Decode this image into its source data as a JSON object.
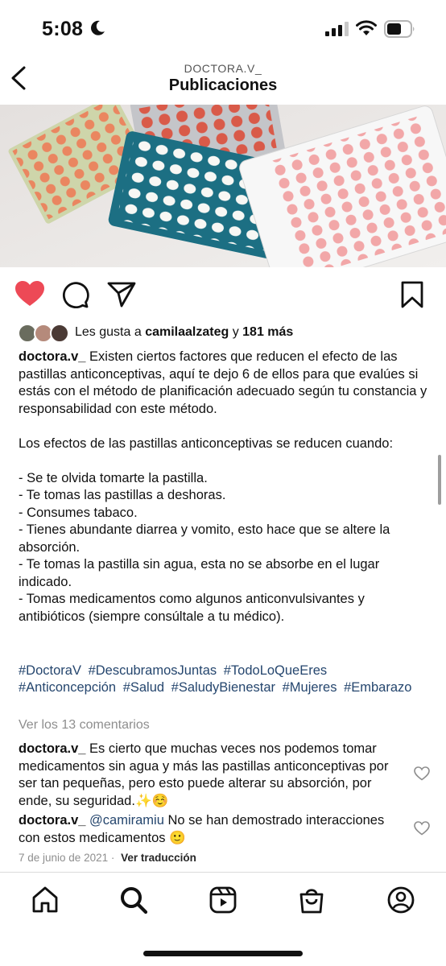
{
  "status_bar": {
    "time": "5:08",
    "icons": [
      "moon-icon",
      "cellular-signal-icon",
      "wifi-icon",
      "battery-icon"
    ]
  },
  "header": {
    "username": "DOCTORA.V_",
    "title": "Publicaciones",
    "back_icon": "chevron-left-icon"
  },
  "actions": {
    "icons": [
      "heart-filled-icon",
      "comment-icon",
      "share-paper-plane-icon",
      "bookmark-icon"
    ],
    "like_color": "#ed4956"
  },
  "likes": {
    "prefix": "Les gusta a",
    "user": "camilaalzateg",
    "connector": "y",
    "others": "181 más"
  },
  "caption": {
    "username": "doctora.v_",
    "intro": "Existen ciertos factores que reducen el efecto de las pastillas anticonceptivas, aquí te dejo 6 de ellos para que evalúes si estás con el método de planificación adecuado según tu constancia y responsabilidad con este método.",
    "effects_intro": "Los efectos de las pastillas anticonceptivas se reducen cuando:",
    "items": [
      "- Se te olvida tomarte la pastilla.",
      "- Te tomas las pastillas a deshoras.",
      "- Consumes tabaco.",
      "- Tienes abundante diarrea y vomito, esto hace que se altere la absorción.",
      "- Te tomas la pastilla sin agua, esta no se absorbe en el lugar indicado.",
      "- Tomas medicamentos como algunos anticonvulsivantes y antibióticos (siempre consúltale a tu médico)."
    ],
    "hashtags": [
      "#DoctoraV",
      "#DescubramosJuntas",
      "#TodoLoQueEres",
      "#Anticoncepción",
      "#Salud",
      "#SaludyBienestar",
      "#Mujeres",
      "#Embarazo"
    ]
  },
  "view_comments": "Ver los 13 comentarios",
  "comments": [
    {
      "username": "doctora.v_",
      "mention": "",
      "text": "Es cierto que muchas veces nos podemos tomar medicamentos sin agua y más las pastillas anticonceptivas por ser tan pequeñas, pero esto puede alterar su absorción, por ende, su seguridad.✨☺️"
    },
    {
      "username": "doctora.v_",
      "mention": "@camiramiu",
      "text": "No se han demostrado interacciones con estos medicamentos 🙂"
    }
  ],
  "meta": {
    "date": "7 de junio de 2021",
    "separator": "·",
    "translate": "Ver traducción"
  },
  "bottom_nav": {
    "icons": [
      "home-icon",
      "search-icon",
      "reels-icon",
      "shop-icon",
      "profile-icon"
    ]
  }
}
